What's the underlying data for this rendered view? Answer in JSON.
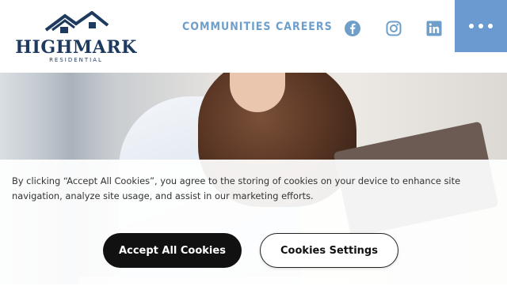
{
  "brand": {
    "name": "HIGHMARK",
    "subtitle": "RESIDENTIAL"
  },
  "nav": {
    "communities": "COMMUNITIES",
    "careers": "CAREERS"
  },
  "social": {
    "facebook": "facebook-icon",
    "instagram": "instagram-icon",
    "linkedin": "linkedin-icon"
  },
  "cookie_banner": {
    "message": "By clicking “Accept All Cookies”, you agree to the storing of cookies on your device to enhance site navigation, analyze site usage, and assist in our marketing efforts.",
    "accept_label": "Accept All Cookies",
    "settings_label": "Cookies Settings"
  },
  "colors": {
    "brand_navy": "#1e3a5f",
    "nav_blue": "#6e9fcb",
    "menu_blue": "#6a9ad0"
  }
}
